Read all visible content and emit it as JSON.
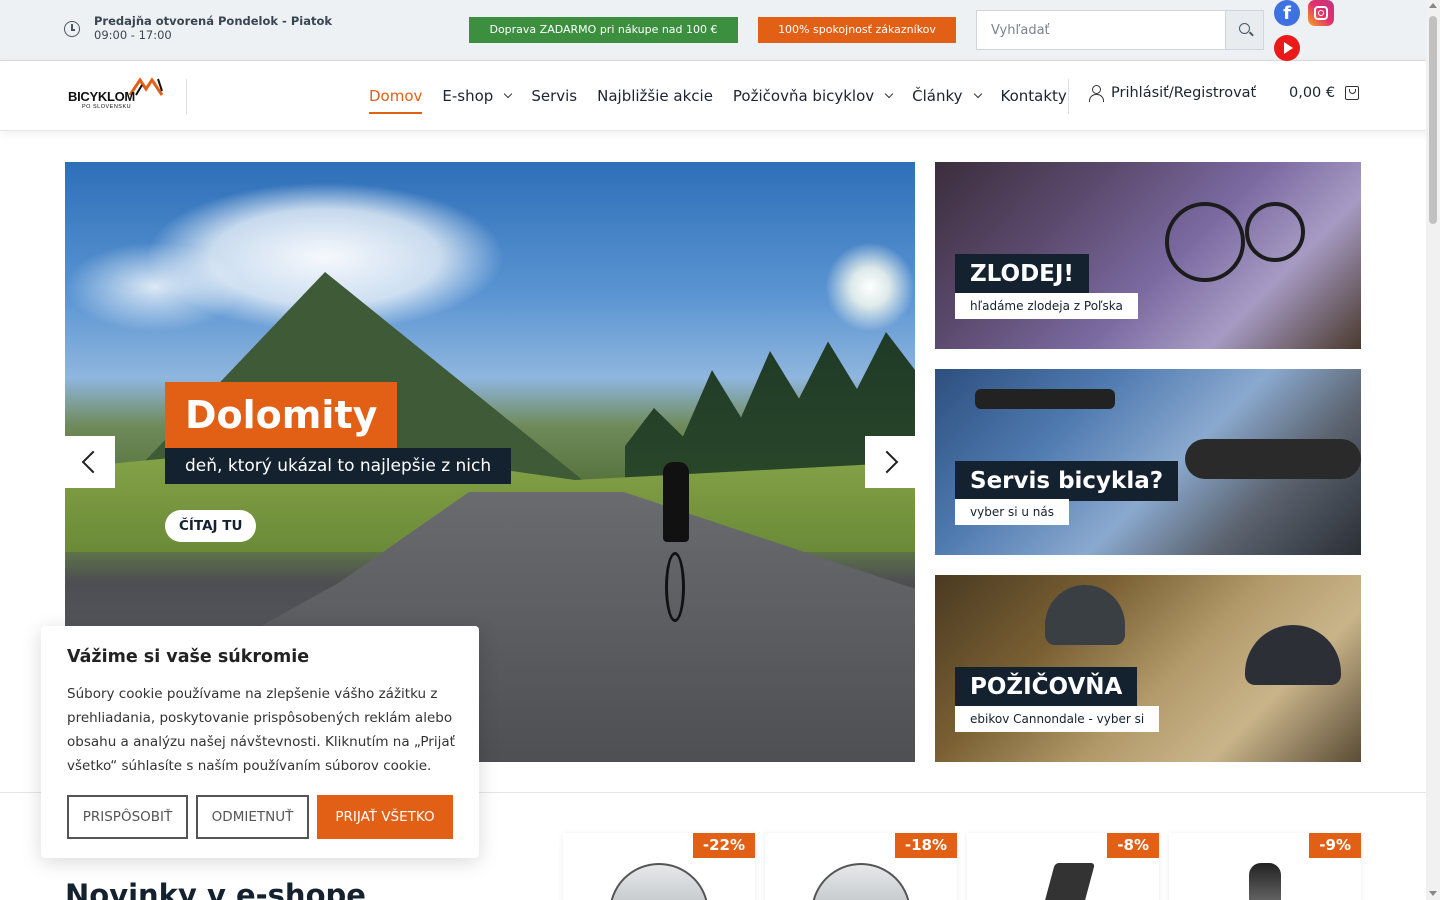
{
  "topbar": {
    "hours_line1": "Predajňa otvorená Pondelok - Piatok",
    "hours_line2": "09:00 - 17:00",
    "promo_shipping": "Doprava ZADARMO pri nákupe nad 100 €",
    "promo_satisfaction": "100% spokojnosť zákazníkov",
    "search_placeholder": "Vyhľadať",
    "social": [
      "facebook-icon",
      "instagram-icon",
      "youtube-icon"
    ]
  },
  "header": {
    "logo_text": "BICYKLOM",
    "logo_subtext": "PO SLOVENSKU",
    "nav": [
      {
        "label": "Domov",
        "active": true,
        "dropdown": false
      },
      {
        "label": "E-shop",
        "active": false,
        "dropdown": true
      },
      {
        "label": "Servis",
        "active": false,
        "dropdown": false
      },
      {
        "label": "Najbližšie akcie",
        "active": false,
        "dropdown": false
      },
      {
        "label": "Požičovňa bicyklov",
        "active": false,
        "dropdown": true
      },
      {
        "label": "Články",
        "active": false,
        "dropdown": true
      },
      {
        "label": "Kontakty",
        "active": false,
        "dropdown": false
      }
    ],
    "account_label": "Prihlásiť/Registrovať",
    "cart_total": "0,00 €"
  },
  "hero": {
    "title": "Dolomity",
    "subtitle": "deň, ktorý ukázal to najlepšie z nich",
    "cta": "ČÍTAJ TU"
  },
  "tiles": [
    {
      "title": "ZLODEJ!",
      "subtitle": "hľadáme zlodeja z Poľska"
    },
    {
      "title": "Servis bicykla?",
      "subtitle": "vyber si u nás"
    },
    {
      "title": "POŽIČOVŇA",
      "subtitle": "ebikov Cannondale - vyber si"
    }
  ],
  "products": {
    "section_title": "Novinky v e-shope",
    "discounts": [
      "-22%",
      "-18%",
      "-8%",
      "-9%"
    ]
  },
  "cookie": {
    "title": "Vážime si vaše súkromie",
    "text": "Súbory cookie používame na zlepšenie vášho zážitku z prehliadania, poskytovanie prispôsobených reklám alebo obsahu a analýzu našej návštevnosti. Kliknutím na „Prijať všetko“ súhlasíte s naším používaním súborov cookie.",
    "btn_customize": "PRISPÔSOBIŤ",
    "btn_reject": "ODMIETNUŤ",
    "btn_accept": "PRIJAŤ VŠETKO"
  },
  "colors": {
    "accent": "#e25f16",
    "promo_green": "#3c8f3f",
    "navy": "#14212e"
  }
}
